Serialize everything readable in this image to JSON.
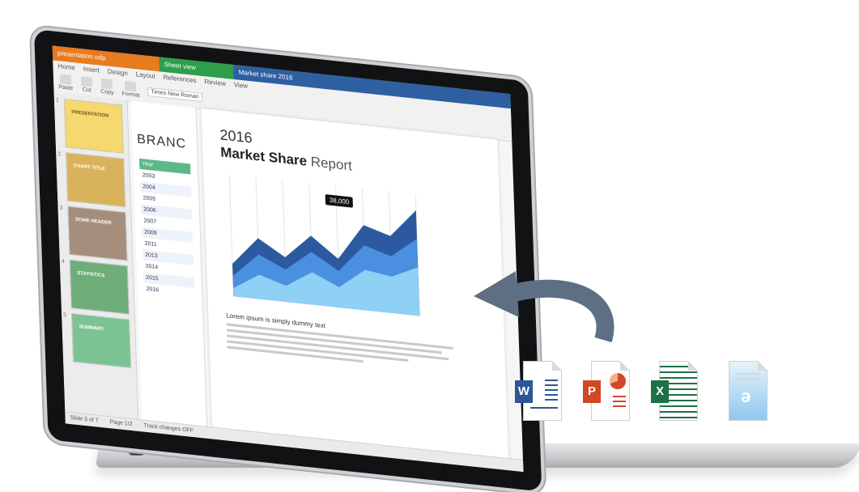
{
  "tabs": [
    {
      "label": "presentation.odp",
      "color": "#e87b1d"
    },
    {
      "label": "Sheet view",
      "color": "#2d9e4b"
    },
    {
      "label": "Market share 2016",
      "color": "#2e5fa1"
    }
  ],
  "ribbon": {
    "menu": [
      "Home",
      "Insert",
      "Design",
      "Layout",
      "References",
      "Review",
      "View"
    ],
    "tools": [
      "Paste",
      "Cut",
      "Copy",
      "Format"
    ],
    "font_name": "Times New Roman"
  },
  "slides": [
    {
      "num": "1",
      "title": "PRESENTATION",
      "color": "#f5d86e"
    },
    {
      "num": "2",
      "title": "CHART TITLE",
      "color": "#d9b35c"
    },
    {
      "num": "3",
      "title": "SOME HEADER",
      "color": "#a68e7c"
    },
    {
      "num": "4",
      "title": "STATISTICS",
      "color": "#6fae7a"
    },
    {
      "num": "5",
      "title": "SUMMARY",
      "color": "#7cc393"
    }
  ],
  "sheet": {
    "title": "BRANC",
    "rows": [
      "Year",
      "2003",
      "2004",
      "2005",
      "2006",
      "2007",
      "2009",
      "2011",
      "2013",
      "2014",
      "2015",
      "2016"
    ]
  },
  "doc": {
    "year": "2016",
    "headline_bold": "Market Share",
    "headline_light": "Report",
    "callout": "38,000",
    "lorem_title": "Lorem ipsum is simply dummy text"
  },
  "status": {
    "left": "Slide 3 of 7",
    "mid": "Page 1/2",
    "right": "Track changes OFF"
  },
  "colors": {
    "word": "#2b5797",
    "ppt": "#d24726",
    "excel": "#1e7145",
    "odt": "#2c8bd1",
    "arrow": "#5e6f84",
    "chart_dark": "#2c5aa0",
    "chart_mid": "#4b8fe0",
    "chart_light": "#8fd0f5"
  },
  "file_icons": [
    {
      "name": "word-icon",
      "letter": "W"
    },
    {
      "name": "powerpoint-icon",
      "letter": "P"
    },
    {
      "name": "excel-icon",
      "letter": "X"
    },
    {
      "name": "odt-icon",
      "letter": "ǝ"
    }
  ],
  "chart_data": {
    "type": "area",
    "x": [
      1,
      2,
      3,
      4,
      5,
      6,
      7,
      8
    ],
    "series": [
      {
        "values": [
          40,
          75,
          55,
          85,
          60,
          105,
          95,
          130
        ]
      },
      {
        "values": [
          25,
          55,
          40,
          65,
          45,
          80,
          70,
          95
        ]
      },
      {
        "values": [
          10,
          30,
          20,
          40,
          25,
          50,
          45,
          60
        ]
      }
    ],
    "ylim": [
      0,
      150
    ],
    "grid": true
  }
}
